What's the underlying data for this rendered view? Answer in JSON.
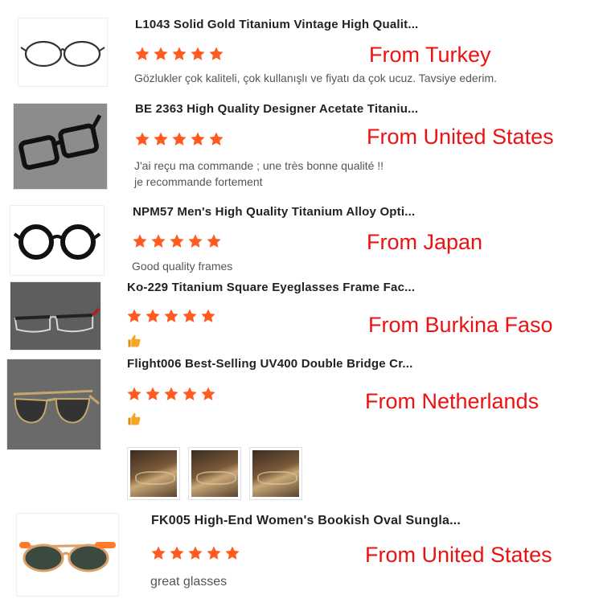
{
  "reviews": [
    {
      "title": "L1043 Solid Gold Titanium Vintage High Qualit...",
      "rating": 5,
      "comment_lines": [
        "Gözlukler çok kaliteli, çok kullanışlı ve fiyatı da çok ucuz. Tavsiye ederim."
      ],
      "origin": "From Turkey",
      "image_icon": "round-metal-glasses-icon"
    },
    {
      "title": "BE 2363 High Quality Designer Acetate Titaniu...",
      "rating": 5,
      "comment_lines": [
        "J'ai reçu ma commande ; une très bonne qualité !!",
        "je recommande fortement"
      ],
      "origin": "From United States",
      "image_icon": "black-acetate-glasses-icon"
    },
    {
      "title": "NPM57 Men's High Quality Titanium Alloy Opti...",
      "rating": 5,
      "comment_lines": [
        "Good quality frames"
      ],
      "origin": "From Japan",
      "image_icon": "black-round-glasses-icon"
    },
    {
      "title": "Ko-229 Titanium Square Eyeglasses Frame Fac...",
      "rating": 5,
      "comment_icon": "thumbs-up-icon",
      "origin": "From Burkina Faso",
      "image_icon": "half-rim-titanium-glasses-icon"
    },
    {
      "title": "Flight006 Best-Selling UV400 Double Bridge Cr...",
      "rating": 5,
      "comment_icon": "thumbs-up-icon",
      "photo_count": 3,
      "origin": "From Netherlands",
      "image_icon": "aviator-sunglasses-icon"
    },
    {
      "title": "FK005 High-End Women's Bookish Oval Sungla...",
      "rating": 5,
      "comment_lines": [
        "great glasses"
      ],
      "origin": "From United States",
      "image_icon": "oval-sunglasses-icon"
    }
  ],
  "colors": {
    "star": "#ff5a1f",
    "origin_text": "#ee1111",
    "thumbs_up": "#f5a623"
  }
}
